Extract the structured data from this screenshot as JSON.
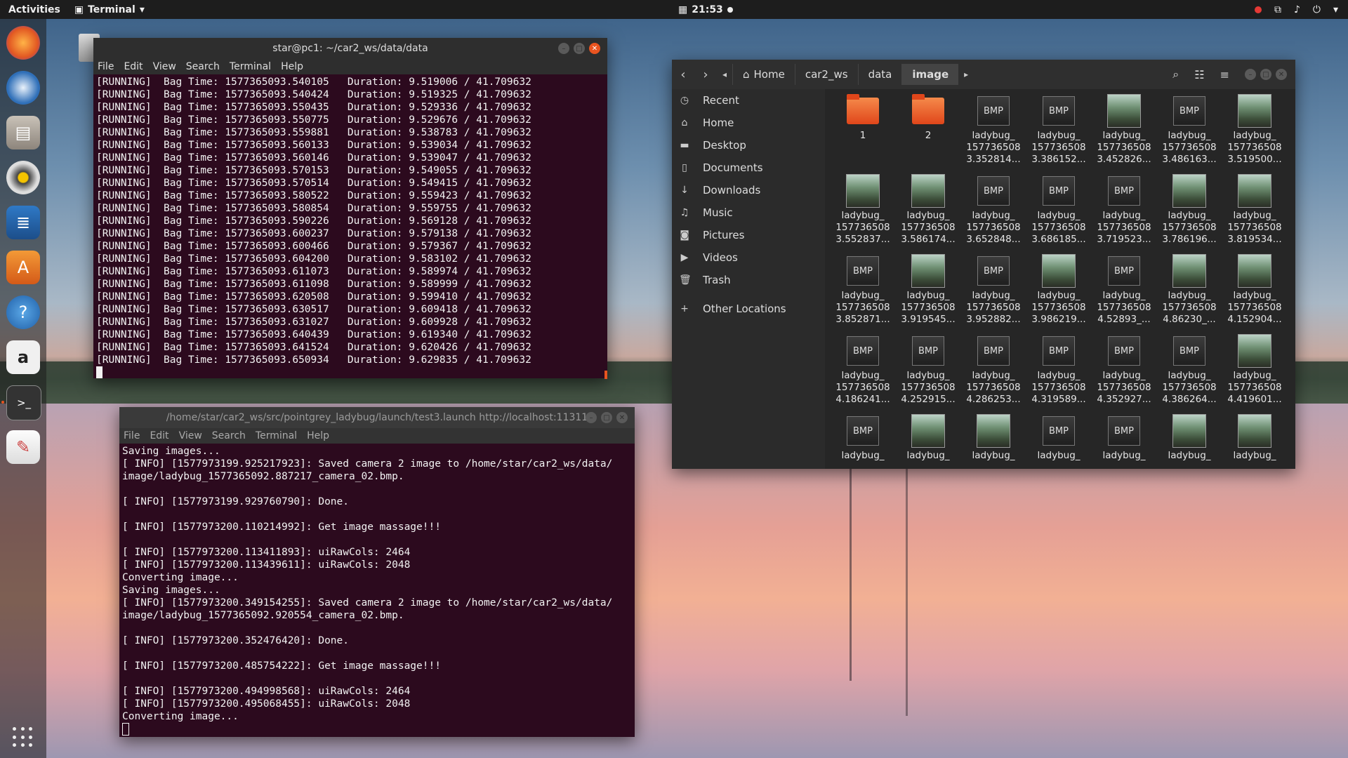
{
  "topbar": {
    "activities": "Activities",
    "app_name": "Terminal",
    "time": "21:53"
  },
  "dock": {
    "items": [
      "firefox-icon",
      "thunderbird-icon",
      "files-icon",
      "rhythmbox-icon",
      "writer-icon",
      "software-icon",
      "help-icon",
      "amazon-icon",
      "terminal-icon",
      "text-editor-icon"
    ]
  },
  "term1": {
    "title": "star@pc1: ~/car2_ws/data/data",
    "menu": [
      "File",
      "Edit",
      "View",
      "Search",
      "Terminal",
      "Help"
    ],
    "lines": [
      "[RUNNING]  Bag Time: 1577365093.540105   Duration: 9.519006 / 41.709632",
      "[RUNNING]  Bag Time: 1577365093.540424   Duration: 9.519325 / 41.709632",
      "[RUNNING]  Bag Time: 1577365093.550435   Duration: 9.529336 / 41.709632",
      "[RUNNING]  Bag Time: 1577365093.550775   Duration: 9.529676 / 41.709632",
      "[RUNNING]  Bag Time: 1577365093.559881   Duration: 9.538783 / 41.709632",
      "[RUNNING]  Bag Time: 1577365093.560133   Duration: 9.539034 / 41.709632",
      "[RUNNING]  Bag Time: 1577365093.560146   Duration: 9.539047 / 41.709632",
      "[RUNNING]  Bag Time: 1577365093.570153   Duration: 9.549055 / 41.709632",
      "[RUNNING]  Bag Time: 1577365093.570514   Duration: 9.549415 / 41.709632",
      "[RUNNING]  Bag Time: 1577365093.580522   Duration: 9.559423 / 41.709632",
      "[RUNNING]  Bag Time: 1577365093.580854   Duration: 9.559755 / 41.709632",
      "[RUNNING]  Bag Time: 1577365093.590226   Duration: 9.569128 / 41.709632",
      "[RUNNING]  Bag Time: 1577365093.600237   Duration: 9.579138 / 41.709632",
      "[RUNNING]  Bag Time: 1577365093.600466   Duration: 9.579367 / 41.709632",
      "[RUNNING]  Bag Time: 1577365093.604200   Duration: 9.583102 / 41.709632",
      "[RUNNING]  Bag Time: 1577365093.611073   Duration: 9.589974 / 41.709632",
      "[RUNNING]  Bag Time: 1577365093.611098   Duration: 9.589999 / 41.709632",
      "[RUNNING]  Bag Time: 1577365093.620508   Duration: 9.599410 / 41.709632",
      "[RUNNING]  Bag Time: 1577365093.630517   Duration: 9.609418 / 41.709632",
      "[RUNNING]  Bag Time: 1577365093.631027   Duration: 9.609928 / 41.709632",
      "[RUNNING]  Bag Time: 1577365093.640439   Duration: 9.619340 / 41.709632",
      "[RUNNING]  Bag Time: 1577365093.641524   Duration: 9.620426 / 41.709632",
      "[RUNNING]  Bag Time: 1577365093.650934   Duration: 9.629835 / 41.709632"
    ]
  },
  "term2": {
    "title": "/home/star/car2_ws/src/pointgrey_ladybug/launch/test3.launch http://localhost:11311",
    "menu": [
      "File",
      "Edit",
      "View",
      "Search",
      "Terminal",
      "Help"
    ],
    "lines": [
      "Saving images...",
      "[ INFO] [1577973199.925217923]: Saved camera 2 image to /home/star/car2_ws/data/",
      "image/ladybug_1577365092.887217_camera_02.bmp.",
      "",
      "[ INFO] [1577973199.929760790]: Done.",
      "",
      "[ INFO] [1577973200.110214992]: Get image massage!!!",
      "",
      "[ INFO] [1577973200.113411893]: uiRawCols: 2464",
      "[ INFO] [1577973200.113439611]: uiRawCols: 2048",
      "Converting image...",
      "Saving images...",
      "[ INFO] [1577973200.349154255]: Saved camera 2 image to /home/star/car2_ws/data/",
      "image/ladybug_1577365092.920554_camera_02.bmp.",
      "",
      "[ INFO] [1577973200.352476420]: Done.",
      "",
      "[ INFO] [1577973200.485754222]: Get image massage!!!",
      "",
      "[ INFO] [1577973200.494998568]: uiRawCols: 2464",
      "[ INFO] [1577973200.495068455]: uiRawCols: 2048",
      "Converting image..."
    ]
  },
  "files": {
    "breadcrumbs": [
      "Home",
      "car2_ws",
      "data",
      "image"
    ],
    "sidebar": [
      "Recent",
      "Home",
      "Desktop",
      "Documents",
      "Downloads",
      "Music",
      "Pictures",
      "Videos",
      "Trash",
      "Other Locations"
    ],
    "items": [
      {
        "type": "folder",
        "l1": "1",
        "l2": "",
        "l3": ""
      },
      {
        "type": "folder",
        "l1": "2",
        "l2": "",
        "l3": ""
      },
      {
        "type": "bmp",
        "l1": "ladybug_",
        "l2": "157736508",
        "l3": "3.352814..."
      },
      {
        "type": "bmp",
        "l1": "ladybug_",
        "l2": "157736508",
        "l3": "3.386152..."
      },
      {
        "type": "thumb",
        "l1": "ladybug_",
        "l2": "157736508",
        "l3": "3.452826..."
      },
      {
        "type": "bmp",
        "l1": "ladybug_",
        "l2": "157736508",
        "l3": "3.486163..."
      },
      {
        "type": "thumb",
        "l1": "ladybug_",
        "l2": "157736508",
        "l3": "3.519500..."
      },
      {
        "type": "thumb",
        "l1": "ladybug_",
        "l2": "157736508",
        "l3": "3.552837..."
      },
      {
        "type": "thumb",
        "l1": "ladybug_",
        "l2": "157736508",
        "l3": "3.586174..."
      },
      {
        "type": "bmp",
        "l1": "ladybug_",
        "l2": "157736508",
        "l3": "3.652848..."
      },
      {
        "type": "bmp",
        "l1": "ladybug_",
        "l2": "157736508",
        "l3": "3.686185..."
      },
      {
        "type": "bmp",
        "l1": "ladybug_",
        "l2": "157736508",
        "l3": "3.719523..."
      },
      {
        "type": "thumb",
        "l1": "ladybug_",
        "l2": "157736508",
        "l3": "3.786196..."
      },
      {
        "type": "thumb",
        "l1": "ladybug_",
        "l2": "157736508",
        "l3": "3.819534..."
      },
      {
        "type": "bmp",
        "l1": "ladybug_",
        "l2": "157736508",
        "l3": "3.852871..."
      },
      {
        "type": "thumb",
        "l1": "ladybug_",
        "l2": "157736508",
        "l3": "3.919545..."
      },
      {
        "type": "bmp",
        "l1": "ladybug_",
        "l2": "157736508",
        "l3": "3.952882..."
      },
      {
        "type": "thumb",
        "l1": "ladybug_",
        "l2": "157736508",
        "l3": "3.986219..."
      },
      {
        "type": "bmp",
        "l1": "ladybug_",
        "l2": "157736508",
        "l3": "4.52893_..."
      },
      {
        "type": "thumb",
        "l1": "ladybug_",
        "l2": "157736508",
        "l3": "4.86230_..."
      },
      {
        "type": "thumb",
        "l1": "ladybug_",
        "l2": "157736508",
        "l3": "4.152904..."
      },
      {
        "type": "bmp",
        "l1": "ladybug_",
        "l2": "157736508",
        "l3": "4.186241..."
      },
      {
        "type": "bmp",
        "l1": "ladybug_",
        "l2": "157736508",
        "l3": "4.252915..."
      },
      {
        "type": "bmp",
        "l1": "ladybug_",
        "l2": "157736508",
        "l3": "4.286253..."
      },
      {
        "type": "bmp",
        "l1": "ladybug_",
        "l2": "157736508",
        "l3": "4.319589..."
      },
      {
        "type": "bmp",
        "l1": "ladybug_",
        "l2": "157736508",
        "l3": "4.352927..."
      },
      {
        "type": "bmp",
        "l1": "ladybug_",
        "l2": "157736508",
        "l3": "4.386264..."
      },
      {
        "type": "thumb",
        "l1": "ladybug_",
        "l2": "157736508",
        "l3": "4.419601..."
      },
      {
        "type": "bmp",
        "l1": "ladybug_",
        "l2": "",
        "l3": ""
      },
      {
        "type": "thumb",
        "l1": "ladybug_",
        "l2": "",
        "l3": ""
      },
      {
        "type": "thumb",
        "l1": "ladybug_",
        "l2": "",
        "l3": ""
      },
      {
        "type": "bmp",
        "l1": "ladybug_",
        "l2": "",
        "l3": ""
      },
      {
        "type": "bmp",
        "l1": "ladybug_",
        "l2": "",
        "l3": ""
      },
      {
        "type": "thumb",
        "l1": "ladybug_",
        "l2": "",
        "l3": ""
      },
      {
        "type": "thumb",
        "l1": "ladybug_",
        "l2": "",
        "l3": ""
      }
    ],
    "bmp_label": "BMP"
  }
}
